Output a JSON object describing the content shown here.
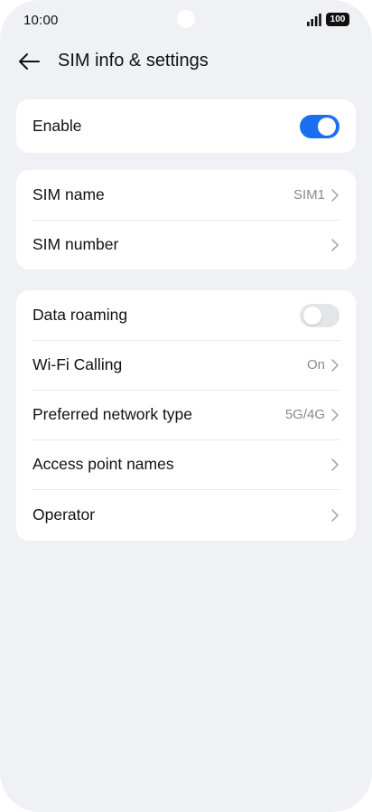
{
  "status_bar": {
    "time": "10:00",
    "battery": "100",
    "icons": [
      "signal-icon",
      "battery-icon"
    ]
  },
  "header": {
    "title": "SIM info & settings",
    "back_icon": "arrow-left-icon"
  },
  "cards": {
    "enable": {
      "label": "Enable",
      "toggle_on": true
    },
    "sim": {
      "name_label": "SIM name",
      "name_value": "SIM1",
      "number_label": "SIM number"
    },
    "network": {
      "roaming_label": "Data roaming",
      "roaming_on": false,
      "wifi_calling_label": "Wi-Fi Calling",
      "wifi_calling_value": "On",
      "preferred_label": "Preferred network type",
      "preferred_value": "5G/4G",
      "apn_label": "Access point names",
      "operator_label": "Operator"
    }
  },
  "colors": {
    "accent": "#1a6ff0",
    "background": "#f0f1f5",
    "card": "#ffffff",
    "secondary_text": "#8a8a8f"
  }
}
